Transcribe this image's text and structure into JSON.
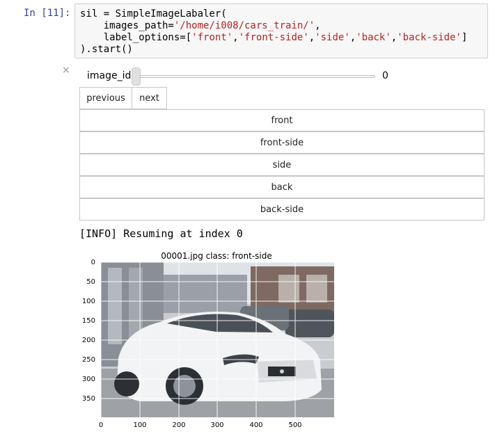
{
  "cell": {
    "prompt": "In [11]:",
    "code": {
      "line1": "sil = SimpleImageLabaler(",
      "line2_kw": "    images_path=",
      "line2_str": "'/home/i008/cars_train/'",
      "line2_end": ",",
      "line3_kw": "    label_options=[",
      "line3_s1": "'front'",
      "line3_s2": "'front-side'",
      "line3_s3": "'side'",
      "line3_s4": "'back'",
      "line3_s5": "'back-side'",
      "line3_end": "]",
      "line4": ").start()",
      "comma": ","
    }
  },
  "widget": {
    "close_symbol": "×",
    "slider": {
      "label": "image_id",
      "value": "0",
      "min": 0,
      "fill_fraction": 0.0
    },
    "nav": {
      "previous": "previous",
      "next": "next"
    },
    "labels": [
      "front",
      "front-side",
      "side",
      "back",
      "back-side"
    ]
  },
  "output": {
    "info": "[INFO] Resuming at index 0"
  },
  "chart_data": {
    "type": "image",
    "title": "00001.jpg class: front-side",
    "x_ticks": [
      "0",
      "100",
      "200",
      "300",
      "400",
      "500"
    ],
    "y_ticks": [
      "0",
      "50",
      "100",
      "150",
      "200",
      "250",
      "300",
      "350"
    ],
    "x_range": [
      0,
      600
    ],
    "y_range": [
      0,
      400
    ],
    "grid": true,
    "image_subject": "white coupe car in a dealership parking lot"
  }
}
